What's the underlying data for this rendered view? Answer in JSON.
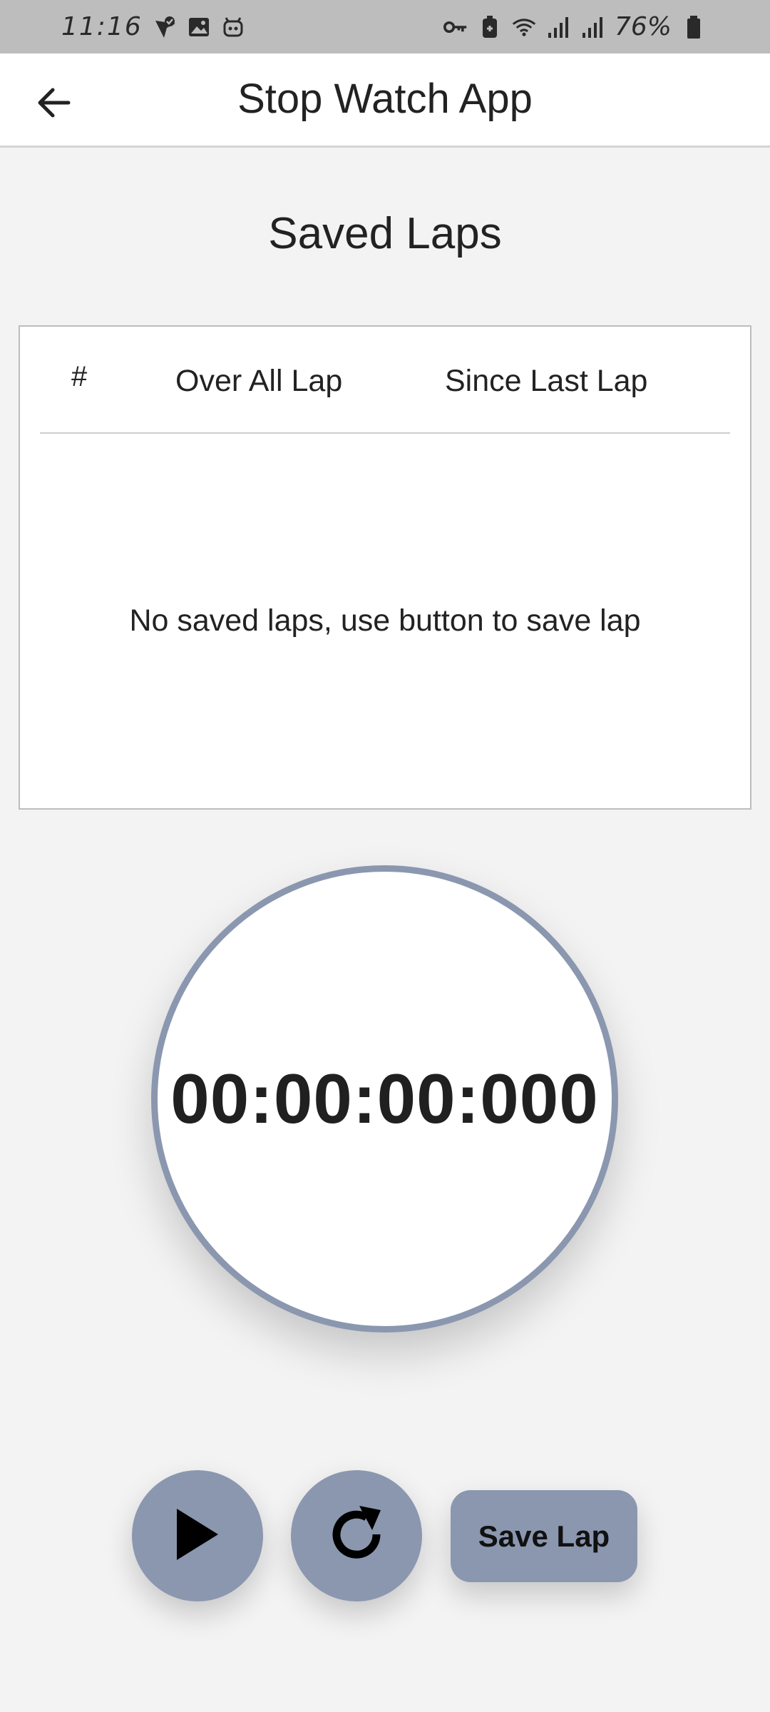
{
  "status_bar": {
    "time": "11:16",
    "battery_percent": "76%",
    "left_icons": [
      "location-check-icon",
      "image-icon",
      "robot-icon"
    ],
    "right_icons": [
      "key-icon",
      "battery-saver-icon",
      "wifi-icon",
      "signal-icon",
      "signal-icon",
      "battery-icon"
    ]
  },
  "app_bar": {
    "title": "Stop Watch App",
    "back_icon": "arrow-left-icon"
  },
  "laps": {
    "title": "Saved Laps",
    "columns": [
      "#",
      "Over All Lap",
      "Since Last Lap"
    ],
    "rows": [],
    "empty_message": "No saved laps, use button to save lap"
  },
  "timer": {
    "display": "00:00:00:000"
  },
  "controls": {
    "play_icon": "play-icon",
    "reset_icon": "refresh-icon",
    "save_label": "Save Lap"
  },
  "colors": {
    "accent": "#8a97af",
    "background": "#f3f3f4",
    "status_bar": "#bdbdbd",
    "card": "#ffffff"
  }
}
